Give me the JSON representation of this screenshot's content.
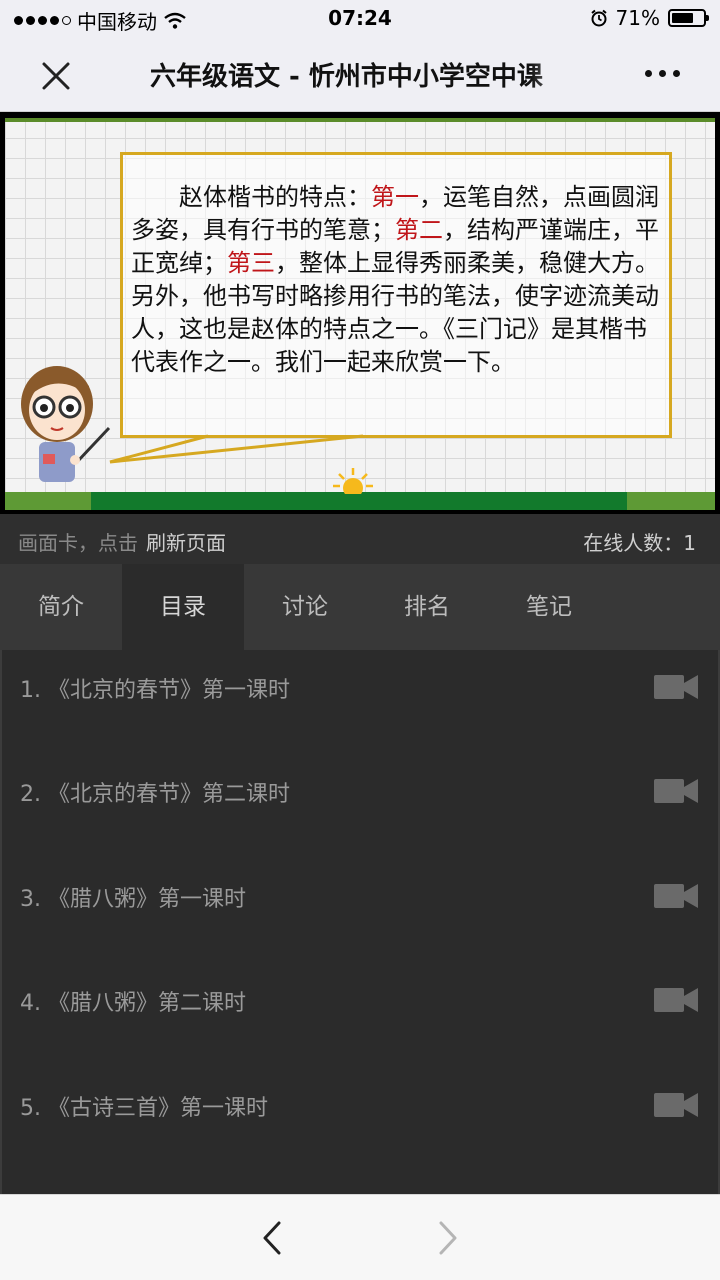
{
  "status_bar": {
    "carrier": "中国移动",
    "time": "07:24",
    "battery_percent": "71%",
    "battery_level": 0.71
  },
  "nav": {
    "title": "六年级语文 - 忻州市中小学空中课"
  },
  "slide": {
    "text_part1": "赵体楷书的特点：",
    "emphasis1": "第一",
    "text_part2": "，运笔自然，点画圆润多姿，具有行书的笔意；",
    "emphasis2": "第二",
    "text_part3": "，结构严谨端庄，平正宽绰；",
    "emphasis3": "第三",
    "text_part4": "，整体上显得秀丽柔美，稳健大方。另外，他书写时略掺用行书的笔法，使字迹流美动人，这也是赵体的特点之一。《三门记》是其楷书代表作之一。我们一起来欣赏一下。"
  },
  "info_bar": {
    "hint": "画面卡，点击",
    "refresh_link": "刷新页面",
    "online_label": "在线人数：1"
  },
  "tabs": [
    {
      "label": "简介",
      "active": false
    },
    {
      "label": "目录",
      "active": true
    },
    {
      "label": "讨论",
      "active": false
    },
    {
      "label": "排名",
      "active": false
    },
    {
      "label": "笔记",
      "active": false
    }
  ],
  "lessons": [
    {
      "label": "1. 《北京的春节》第一课时",
      "icon": "video-camera-icon"
    },
    {
      "label": "2. 《北京的春节》第二课时",
      "icon": "video-camera-icon"
    },
    {
      "label": "3. 《腊八粥》第一课时",
      "icon": "video-camera-icon"
    },
    {
      "label": "4. 《腊八粥》第二课时",
      "icon": "video-camera-icon"
    },
    {
      "label": "5. 《古诗三首》第一课时",
      "icon": "video-camera-icon"
    }
  ],
  "colors": {
    "accent_red": "#c0161a",
    "box_border": "#d6a820",
    "ground_green": "#127a2c",
    "list_bg": "#2b2b2b"
  }
}
